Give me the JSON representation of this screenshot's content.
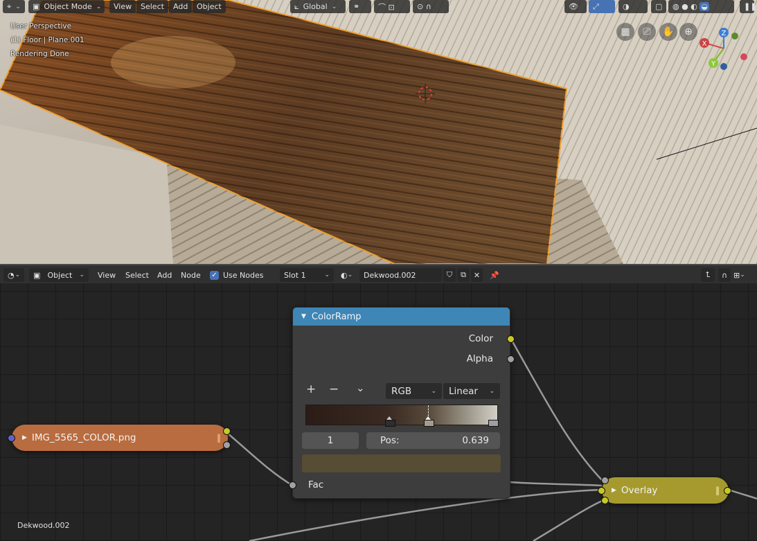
{
  "viewport": {
    "header": {
      "mode": "Object Mode",
      "menu": [
        "View",
        "Select",
        "Add",
        "Object"
      ],
      "orientation": "Global"
    },
    "info": {
      "perspective": "User Perspective",
      "object": "(1) Floor | Plane.001",
      "status": "Rendering Done"
    },
    "gizmo": {
      "z": "Z",
      "x": "X",
      "y": "Y"
    }
  },
  "node_editor": {
    "header": {
      "editor_type": "Object",
      "menu": [
        "View",
        "Select",
        "Add",
        "Node"
      ],
      "use_nodes_label": "Use Nodes",
      "use_nodes_checked": true,
      "slot": "Slot 1",
      "material": "Dekwood.002"
    },
    "colorramp": {
      "title": "ColorRamp",
      "outputs": [
        "Color",
        "Alpha"
      ],
      "add": "+",
      "remove": "−",
      "color_mode": "RGB",
      "interpolation": "Linear",
      "active_index": "1",
      "pos_label": "Pos:",
      "pos_value": "0.639",
      "input": "Fac",
      "active_color": "#574c34"
    },
    "image_node": {
      "label": "IMG_5565_COLOR.png",
      "color": "#b96c3f"
    },
    "overlay_node": {
      "label": "Overlay",
      "color": "#a69a2f"
    },
    "footer": "Dekwood.002"
  }
}
